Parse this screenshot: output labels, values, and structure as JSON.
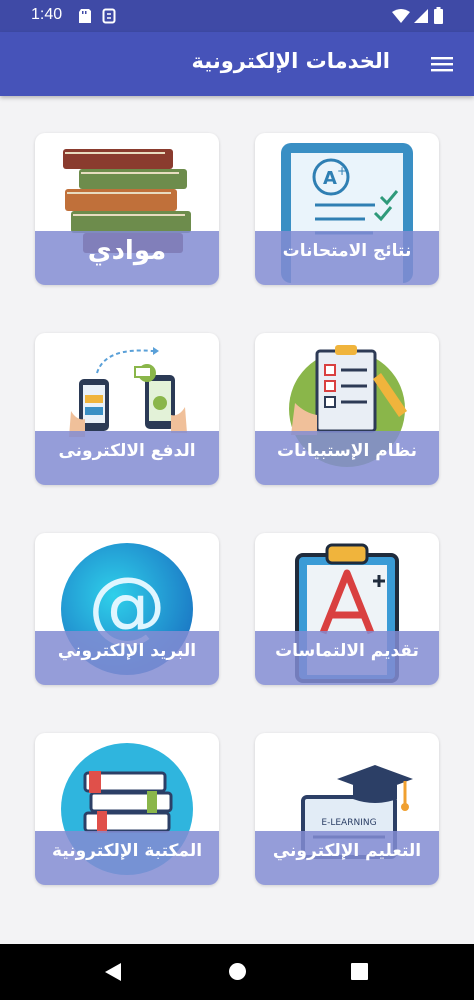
{
  "status_bar": {
    "time": "1:40"
  },
  "app_bar": {
    "title": "الخدمات الإلكترونية",
    "menu_icon": "hamburger-menu-icon"
  },
  "cards": [
    {
      "label": "نتائج الامتحانات",
      "icon": "exam-results-icon"
    },
    {
      "label": "موادي",
      "icon": "books-stack-icon"
    },
    {
      "label": "نظام الإستبيانات",
      "icon": "survey-clipboard-icon"
    },
    {
      "label": "الدفع الالكترونى",
      "icon": "mobile-payment-icon"
    },
    {
      "label": "تقديم الالتماسات",
      "icon": "petition-clipboard-icon"
    },
    {
      "label": "البريد الإلكتروني",
      "icon": "email-at-icon"
    },
    {
      "label": "التعليم الإلكتروني",
      "icon": "graduation-cap-laptop-icon"
    },
    {
      "label": "المكتبة الإلكترونية",
      "icon": "library-books-icon"
    }
  ],
  "e_learning_screen_text": "E-LEARNING",
  "colors": {
    "app_bar": "#4653b9",
    "status_bar": "#3f4aa6",
    "card_band": "#828cd2",
    "background": "#f3f3f5"
  },
  "nav_bar": {
    "back_icon": "back-triangle-icon",
    "home_icon": "home-circle-icon",
    "recents_icon": "recents-square-icon"
  }
}
